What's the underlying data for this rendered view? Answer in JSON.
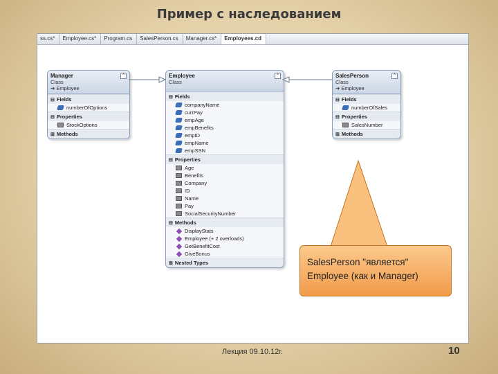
{
  "slide": {
    "title": "Пример с наследованием",
    "footer": "Лекция 09.10.12г.",
    "page_number": "10"
  },
  "tabs": [
    {
      "label": "ss.cs*"
    },
    {
      "label": "Employee.cs*"
    },
    {
      "label": "Program.cs"
    },
    {
      "label": "SalesPerson.cs"
    },
    {
      "label": "Manager.cs*"
    },
    {
      "label": "Employees.cd",
      "active": true
    }
  ],
  "manager": {
    "name": "Manager",
    "kind": "Class",
    "base": "➔ Employee",
    "fields_title": "Fields",
    "fields": [
      "numberOfOptions"
    ],
    "properties_title": "Properties",
    "properties": [
      "StockOptions"
    ],
    "methods_title": "Methods"
  },
  "employee": {
    "name": "Employee",
    "kind": "Class",
    "fields_title": "Fields",
    "fields": [
      "companyName",
      "currPay",
      "empAge",
      "empBenefits",
      "empID",
      "empName",
      "empSSN"
    ],
    "properties_title": "Properties",
    "properties": [
      "Age",
      "Benefits",
      "Company",
      "ID",
      "Name",
      "Pay",
      "SocialSecurityNumber"
    ],
    "methods_title": "Methods",
    "methods": [
      "DisplayStats",
      "Employee (+ 2 overloads)",
      "GetBenefitCost",
      "GiveBonus"
    ],
    "nested_title": "Nested Types"
  },
  "salesperson": {
    "name": "SalesPerson",
    "kind": "Class",
    "base": "➔ Employee",
    "fields_title": "Fields",
    "fields": [
      "numberOfSales"
    ],
    "properties_title": "Properties",
    "properties": [
      "SalesNumber"
    ],
    "methods_title": "Methods"
  },
  "callout": {
    "line1": "SalesPerson \"является\"",
    "line2": "Employee (как и Manager)"
  },
  "colors": {
    "callout_fill": "#f5a85a",
    "box_border": "#8aa0bb"
  }
}
